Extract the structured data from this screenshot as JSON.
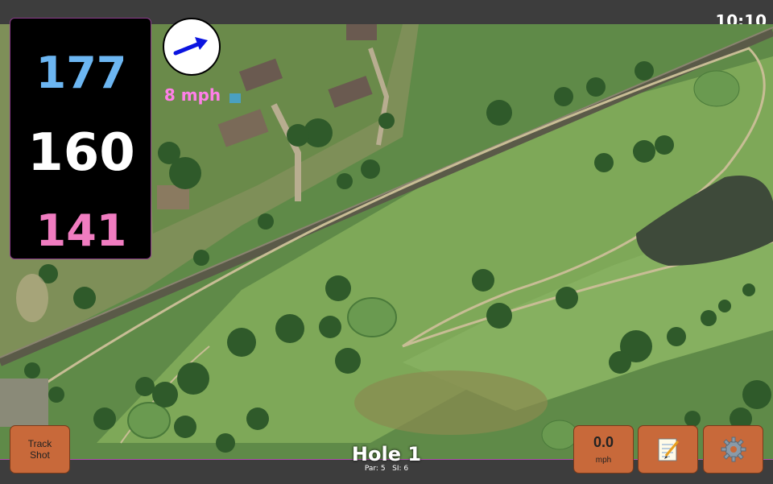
{
  "status": {
    "time": "10:10"
  },
  "distances": {
    "back": "177",
    "middle": "160",
    "front": "141",
    "back_color": "#6cb6f2",
    "middle_color": "#ffffff",
    "front_color": "#f07cc0"
  },
  "wind": {
    "speed": "8 mph",
    "icon": "wind-arrow-icon"
  },
  "hole": {
    "title": "Hole 1",
    "par": "Par: 5",
    "si": "SI: 6"
  },
  "buttons": {
    "track_line1": "Track",
    "track_line2": "Shot",
    "speed_value": "0.0",
    "speed_unit": "mph",
    "notes_icon": "notepad-icon",
    "settings_icon": "gear-icon",
    "button_color": "#c8693a"
  },
  "map": {
    "type": "satellite-course-view"
  }
}
